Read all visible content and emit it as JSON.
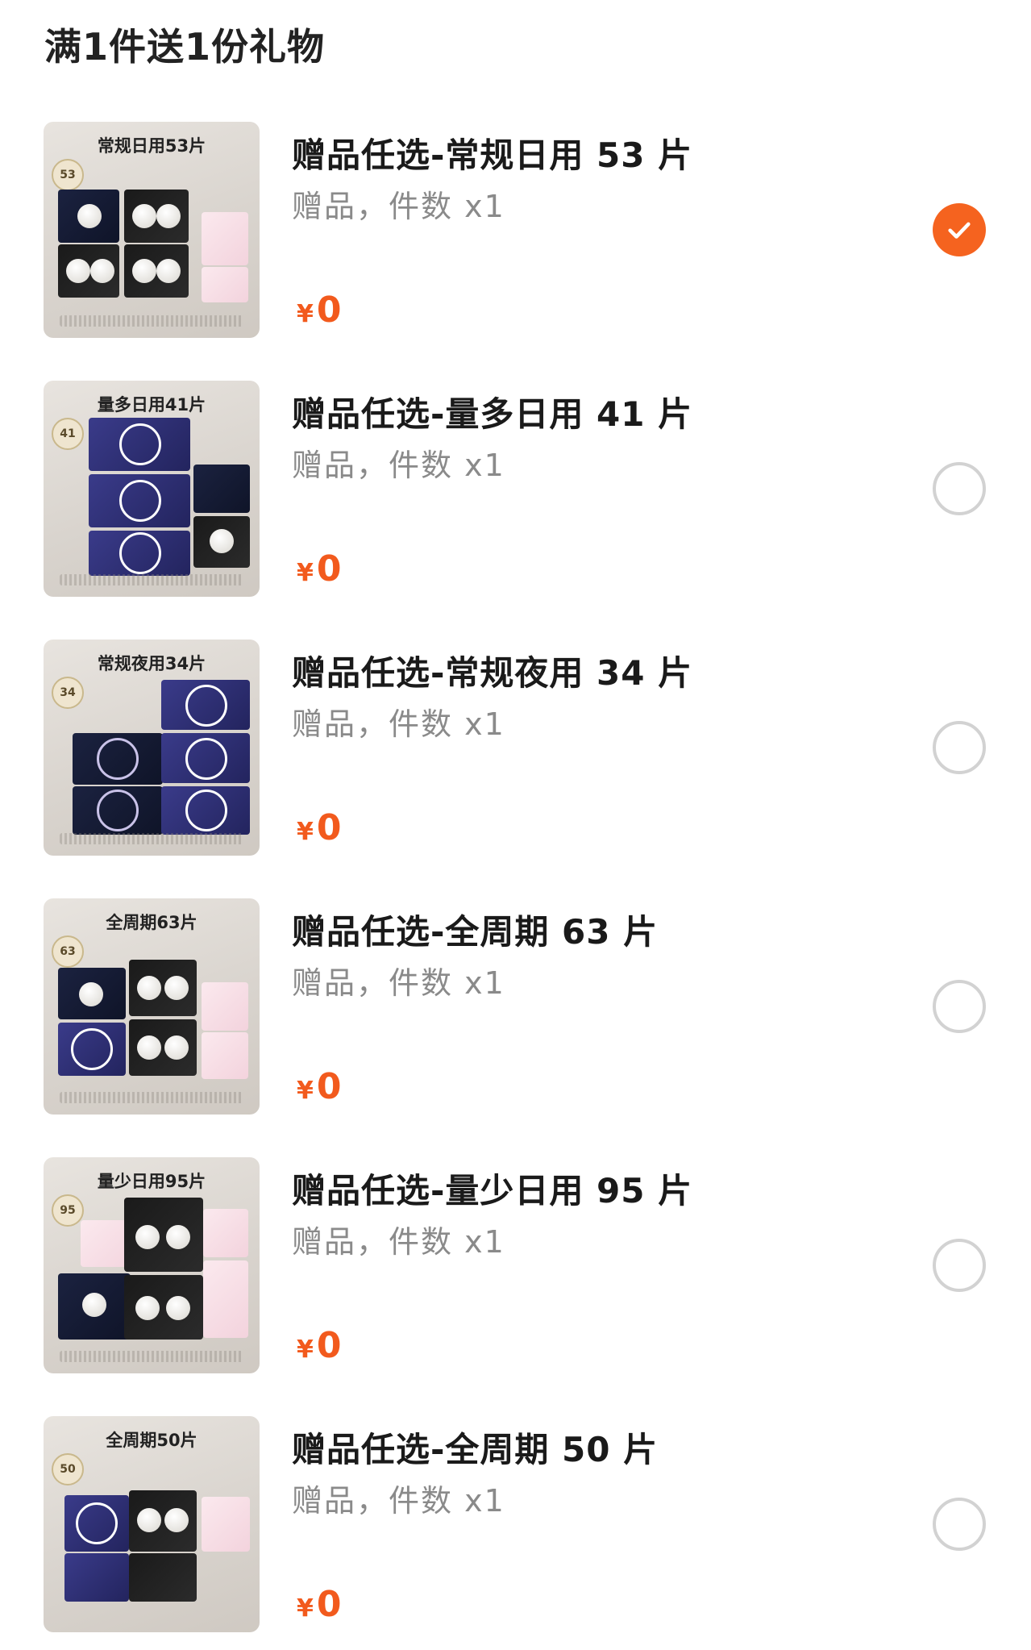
{
  "header": {
    "title": "满1件送1份礼物"
  },
  "items": [
    {
      "tag": "常规日用53片",
      "badge": "53",
      "title": "赠品任选-常规日用 53 片",
      "sub": "赠品，件数 x1",
      "currency": "¥",
      "price": "0",
      "selected": true
    },
    {
      "tag": "量多日用41片",
      "badge": "41",
      "title": "赠品任选-量多日用 41 片",
      "sub": "赠品，件数 x1",
      "currency": "¥",
      "price": "0",
      "selected": false
    },
    {
      "tag": "常规夜用34片",
      "badge": "34",
      "title": "赠品任选-常规夜用 34 片",
      "sub": "赠品，件数 x1",
      "currency": "¥",
      "price": "0",
      "selected": false
    },
    {
      "tag": "全周期63片",
      "badge": "63",
      "title": "赠品任选-全周期 63 片",
      "sub": "赠品，件数 x1",
      "currency": "¥",
      "price": "0",
      "selected": false
    },
    {
      "tag": "量少日用95片",
      "badge": "95",
      "title": "赠品任选-量少日用 95 片",
      "sub": "赠品，件数 x1",
      "currency": "¥",
      "price": "0",
      "selected": false
    },
    {
      "tag": "全周期50片",
      "badge": "50",
      "title": "赠品任选-全周期 50 片",
      "sub": "赠品，件数 x1",
      "currency": "¥",
      "price": "0",
      "selected": false
    }
  ],
  "colors": {
    "accent": "#f5631f",
    "price": "#f25a1d",
    "radio_border": "#d2d2d2"
  },
  "icons": {
    "selected": "check-icon"
  }
}
